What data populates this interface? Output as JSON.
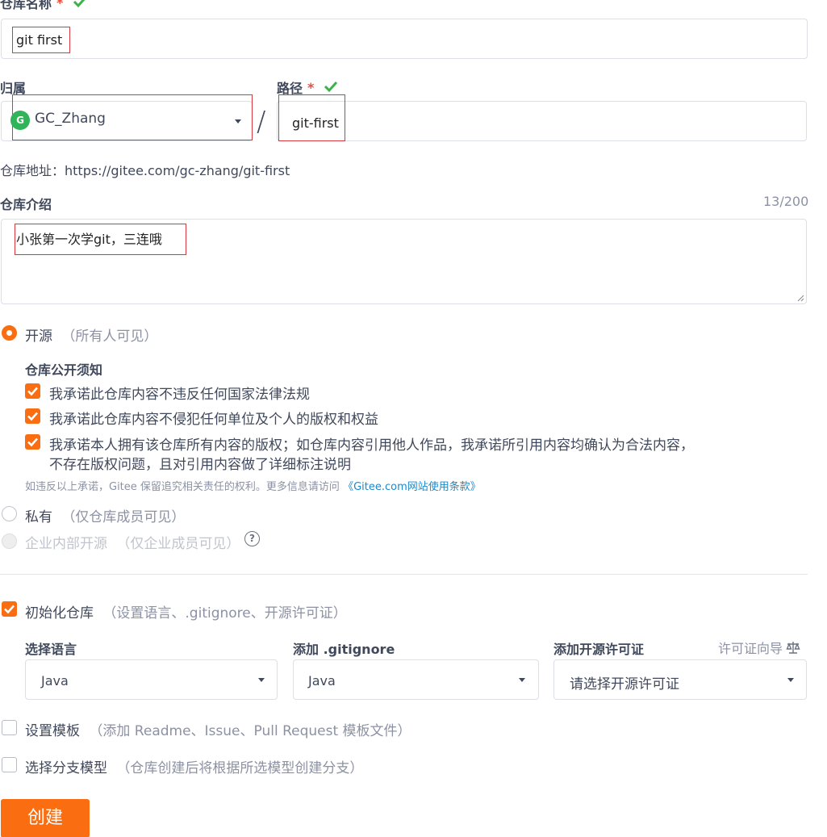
{
  "repo_name": {
    "label": "仓库名称",
    "required_mark": "*",
    "value": "git first"
  },
  "owner": {
    "label": "归属",
    "avatar_letter": "G",
    "value": "GC_Zhang",
    "separator": "/"
  },
  "path": {
    "label": "路径",
    "required_mark": "*",
    "value": "git-first"
  },
  "repo_address": {
    "text": "仓库地址：https://gitee.com/gc-zhang/git-first"
  },
  "description": {
    "label": "仓库介绍",
    "counter": "13/200",
    "value": "小张第一次学git，三连哦"
  },
  "visibility": {
    "open": {
      "label": "开源",
      "hint": "（所有人可见）",
      "selected": true
    },
    "notice_title": "仓库公开须知",
    "promises": [
      "我承诺此仓库内容不违反任何国家法律法规",
      "我承诺此仓库内容不侵犯任何单位及个人的版权和权益",
      "我承诺本人拥有该仓库所有内容的版权；如仓库内容引用他人作品，我承诺所引用内容均确认为合法内容，",
      "不存在版权问题，且对引用内容做了详细标注说明"
    ],
    "legal_note": "如违反以上承诺，Gitee 保留追究相关责任的权利。更多信息请访问",
    "legal_link": "《Gitee.com网站使用条款》",
    "private": {
      "label": "私有",
      "hint": "（仅仓库成员可见）"
    },
    "enterprise": {
      "label": "企业内部开源",
      "hint": "（仅企业成员可见）"
    }
  },
  "init_repo": {
    "label": "初始化仓库",
    "hint": "（设置语言、.gitignore、开源许可证）",
    "checked": true
  },
  "language": {
    "label": "选择语言",
    "value": "Java"
  },
  "gitignore": {
    "label": "添加 .gitignore",
    "value": "Java"
  },
  "license": {
    "label": "添加开源许可证",
    "guide": "许可证向导",
    "placeholder": "请选择开源许可证"
  },
  "template": {
    "label": "设置模板",
    "hint": "（添加 Readme、Issue、Pull Request 模板文件）",
    "checked": false
  },
  "branch_model": {
    "label": "选择分支模型",
    "hint": "（仓库创建后将根据所选模型创建分支）",
    "checked": false
  },
  "create_button": "创建",
  "colors": {
    "accent": "#fa6e11",
    "success": "#3bb34a",
    "link": "#1e88c7",
    "annotation_red": "#d9363e"
  }
}
